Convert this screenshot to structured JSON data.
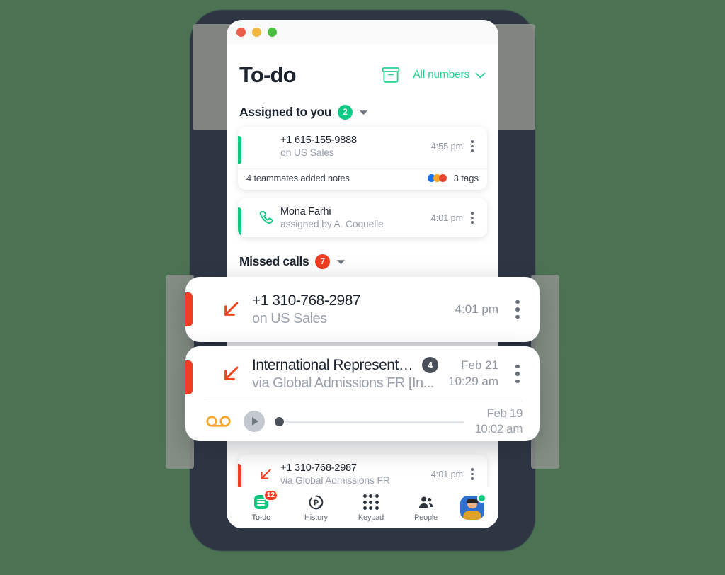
{
  "window": {
    "traffic_lights": [
      "red",
      "yellow",
      "green"
    ]
  },
  "header": {
    "title": "To-do",
    "archive_icon": "archive-box-icon",
    "number_filter": {
      "label": "All numbers",
      "chevron_icon": "chevron-down-icon"
    },
    "accent_color": "#27d08e"
  },
  "sections": [
    {
      "title": "Assigned to you",
      "count": "2",
      "badge_color": "#0ec982",
      "caret_icon": "caret-down-icon"
    },
    {
      "title": "Missed calls",
      "count": "7",
      "badge_color": "#f03c21",
      "caret_icon": "caret-down-icon"
    }
  ],
  "assigned_items": [
    {
      "accent": "green",
      "icon": "none",
      "title": "+1 615-155-9888",
      "subtitle": "on US Sales",
      "time": "4:55 pm",
      "menu_icon": "kebab-menu-icon",
      "footer": {
        "note": "4 teammates added notes",
        "tags_label": "3 tags",
        "tag_colors": [
          "#1a73e8",
          "#f5a623",
          "#e8452c"
        ]
      }
    },
    {
      "accent": "green",
      "icon": "phone-icon",
      "title": "Mona Farhi",
      "subtitle": "assigned by A. Coquelle",
      "time": "4:01 pm",
      "menu_icon": "kebab-menu-icon"
    }
  ],
  "missed_calls_featured": [
    {
      "accent": "red",
      "icon": "incoming-missed-call-arrow-icon",
      "title": "+1 310-768-2987",
      "subtitle": "on US Sales",
      "time": "4:01 pm",
      "menu_icon": "kebab-menu-icon"
    },
    {
      "accent": "red",
      "icon": "incoming-missed-call-arrow-icon",
      "title": "International Representat...",
      "count_badge": "4",
      "subtitle": "via Global Admissions FR [In...",
      "time_date": "Feb 21",
      "time_clock": "10:29 am",
      "menu_icon": "kebab-menu-icon",
      "voicemail": {
        "icon": "voicemail-icon",
        "play_icon": "play-icon",
        "progress": 0,
        "date": "Feb 19",
        "clock": "10:02 am"
      }
    }
  ],
  "missed_calls_list": [
    {
      "accent": "red",
      "icon": "incoming-missed-call-arrow-icon",
      "title": "+1 310-768-2987",
      "subtitle": "via Global Admissions FR",
      "time": "4:01 pm",
      "menu_icon": "kebab-menu-icon"
    }
  ],
  "tabbar": {
    "tabs": [
      {
        "label": "To-do",
        "icon": "todo-list-icon",
        "badge": "12",
        "active": true
      },
      {
        "label": "History",
        "icon": "history-clock-icon",
        "active": false
      },
      {
        "label": "Keypad",
        "icon": "keypad-dots-icon",
        "active": false
      },
      {
        "label": "People",
        "icon": "people-icon",
        "active": false
      }
    ],
    "avatar": {
      "name": "user-avatar",
      "status": "online",
      "status_color": "#0ec982"
    }
  }
}
